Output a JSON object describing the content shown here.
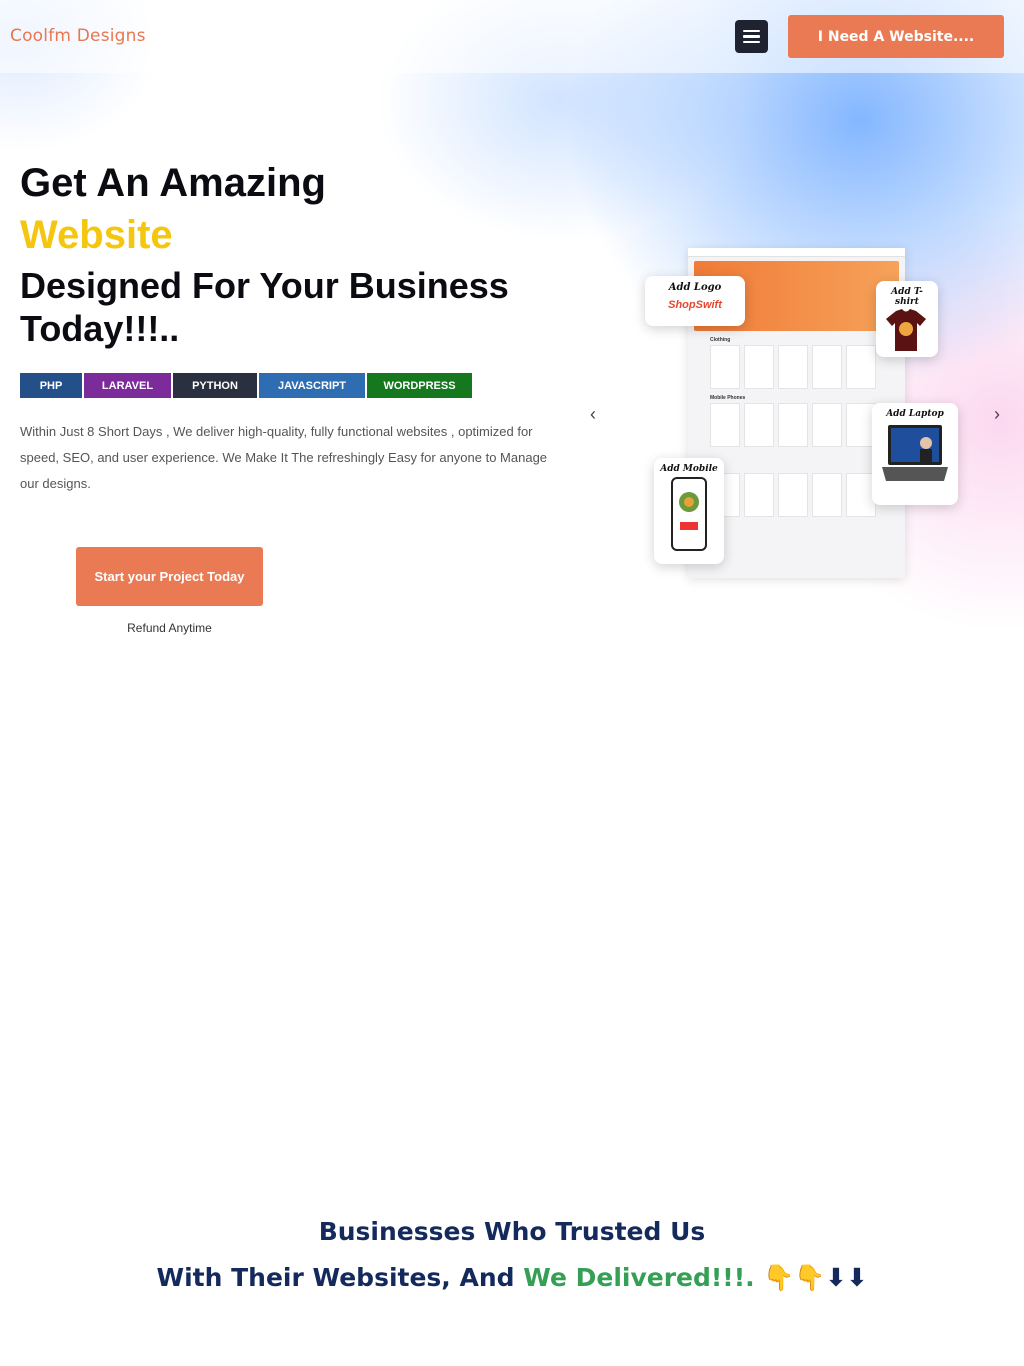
{
  "header": {
    "brand": "Coolfm Designs",
    "cta_label": "I Need A Website....",
    "menu_icon": "hamburger-icon"
  },
  "hero": {
    "line1": "Get An Amazing",
    "line2": "Website",
    "line3": "Designed For Your Business",
    "line4": "Today!!!..",
    "tags": [
      {
        "label": "PHP",
        "color": "#24508a"
      },
      {
        "label": "LARAVEL",
        "color": "#7b2c9a"
      },
      {
        "label": "PYTHON",
        "color": "#2b3040"
      },
      {
        "label": "JAVASCRIPT",
        "color": "#2f6db2"
      },
      {
        "label": "WORDPRESS",
        "color": "#15781e"
      }
    ],
    "description": "Within Just 8 Short Days , We deliver high-quality, fully functional websites , optimized for speed, SEO, and user experience. We Make It The refreshingly Easy for anyone to Manage our designs.",
    "start_button": "Start your Project Today",
    "refund_note": "Refund Anytime"
  },
  "slider": {
    "prev_icon": "chevron-left-icon",
    "next_icon": "chevron-right-icon",
    "prev_glyph": "‹",
    "next_glyph": "›",
    "callouts": {
      "logo": "Add Logo",
      "logo_brand": "ShopSwift",
      "tshirt": "Add T-shirt",
      "laptop": "Add Laptop",
      "mobile": "Add Mobile"
    },
    "mock_sections": [
      "Clothing",
      "Mobile Phones"
    ]
  },
  "trusted": {
    "line1": "Businesses Who Trusted Us",
    "line2_prefix": "With Their Websites, And ",
    "line2_highlight": "We Delivered!!!.",
    "line2_suffix": " 👇👇⬇⬇"
  },
  "colors": {
    "accent_orange": "#ea7a53",
    "headline_yellow": "#f4c60d",
    "navy": "#142a5c",
    "green": "#35a055"
  }
}
